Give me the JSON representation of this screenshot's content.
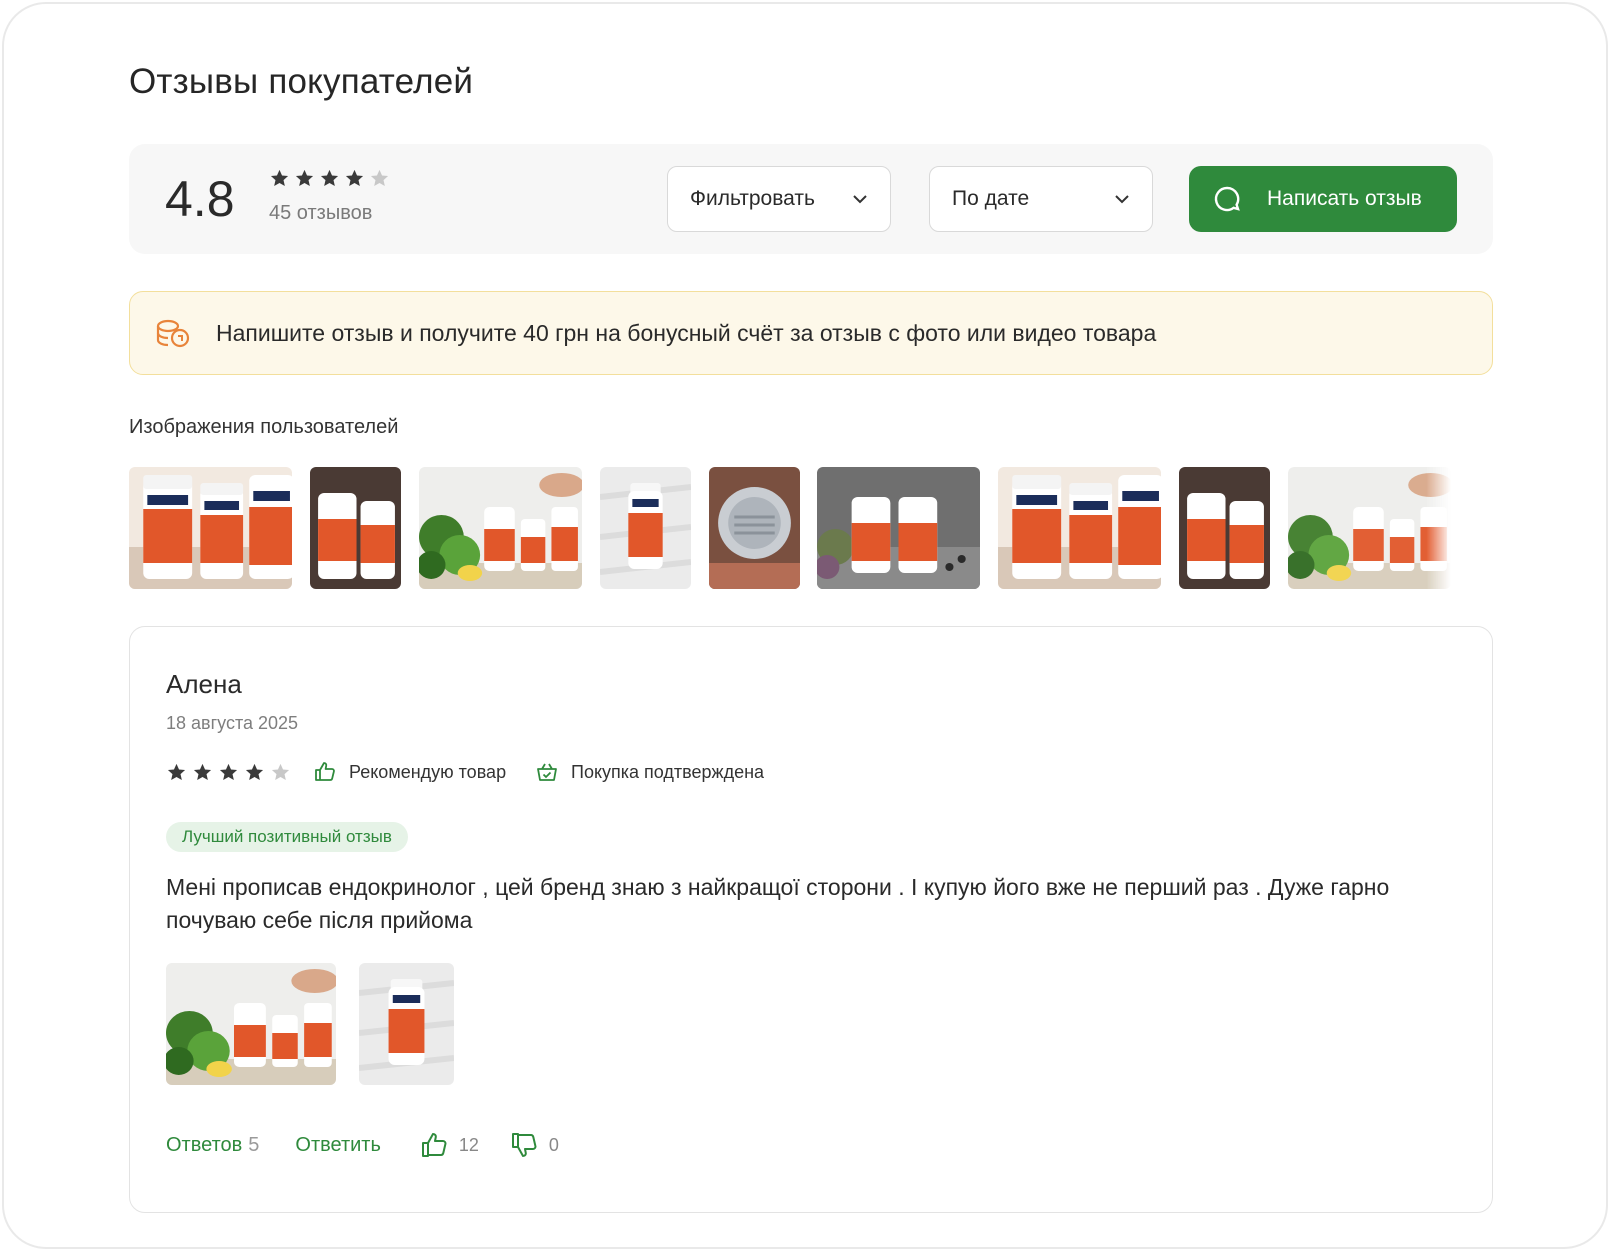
{
  "page": {
    "title": "Отзывы покупателей"
  },
  "summary": {
    "rating": "4.8",
    "rating_value": 4.8,
    "stars_filled": 4,
    "reviews_count": "45 отзывов"
  },
  "controls": {
    "filter_label": "Фильтровать",
    "sort_label": "По дате",
    "write_label": "Написать отзыв"
  },
  "bonus": {
    "text": "Напишите отзыв и получите 40 грн на бонусный счёт за отзыв с фото или видео товара"
  },
  "gallery": {
    "title": "Изображения пользователей"
  },
  "review": {
    "author": "Алена",
    "date": "18 августа 2025",
    "stars_filled": 4,
    "recommend": "Рекомендую товар",
    "verified": "Покупка подтверждена",
    "badge": "Лучший позитивный отзыв",
    "text": "Мені прописав  ендокринолог , цей бренд знаю з найкращої сторони . І купую його вже не  перший раз . Дуже гарно почуваю себе після прийома",
    "replies_label": "Ответов",
    "replies_count": "5",
    "reply_label": "Ответить",
    "likes": "12",
    "dislikes": "0"
  },
  "colors": {
    "accent": "#2f8a3c",
    "bonus_bg": "#fdf8e9",
    "bonus_border": "#f3df9c",
    "bonus_icon": "#e8843a",
    "star_filled": "#3a3a3a",
    "star_empty": "#c8c8c8"
  },
  "icons": {
    "search": "chat-bubble-icon",
    "bonus": "coins-icon",
    "recommend": "thumbs-up-icon",
    "verified": "basket-check-icon",
    "like": "like-icon",
    "dislike": "dislike-icon",
    "chevron": "chevron-down-icon"
  }
}
